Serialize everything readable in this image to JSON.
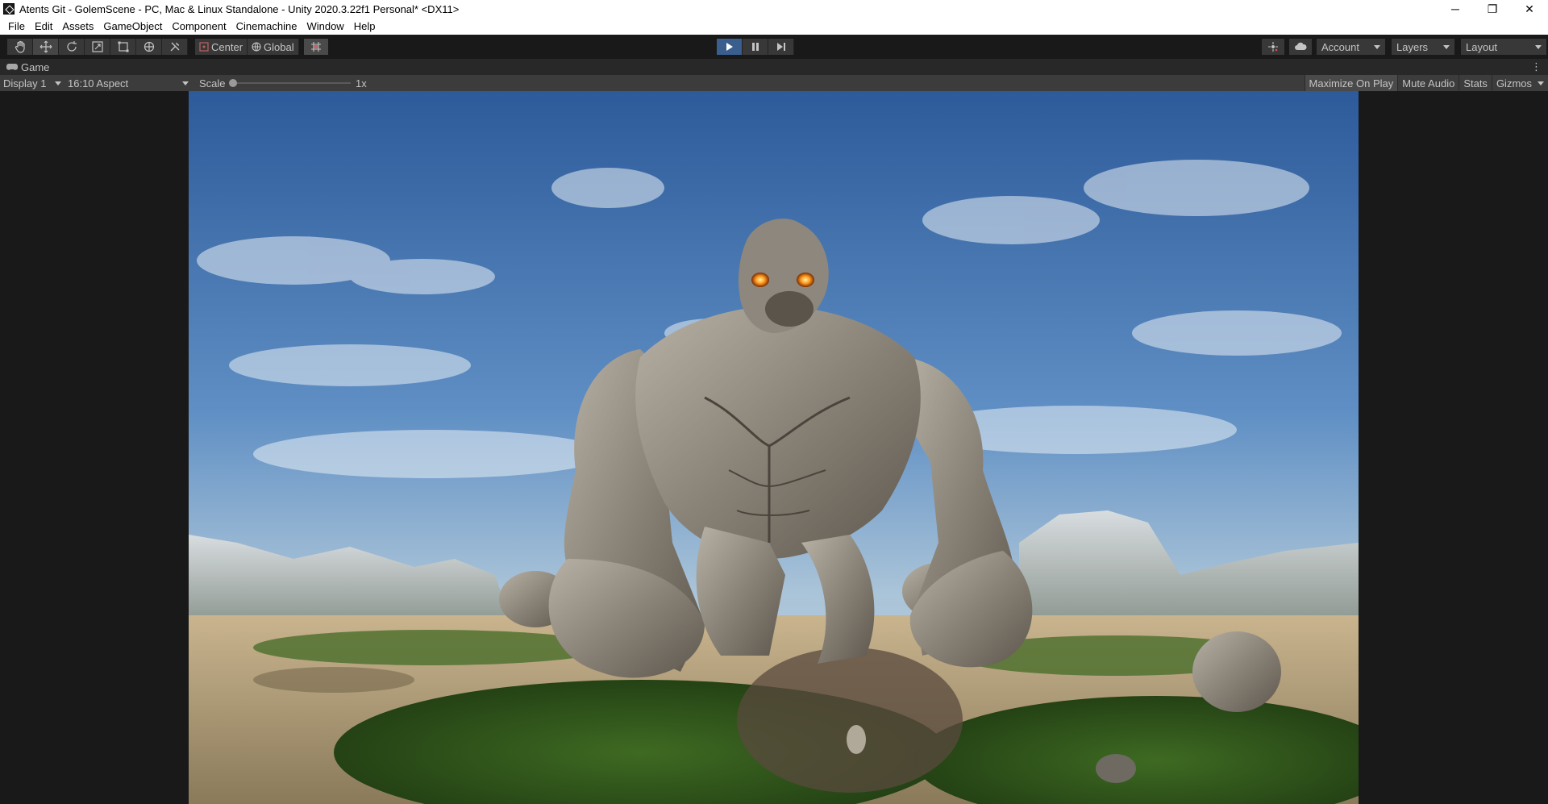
{
  "window": {
    "title": "Atents Git - GolemScene - PC, Mac & Linux Standalone - Unity 2020.3.22f1 Personal* <DX11>",
    "controls": {
      "minimize": "─",
      "restore": "❐",
      "close": "✕"
    }
  },
  "menubar": {
    "items": [
      {
        "label": "File"
      },
      {
        "label": "Edit"
      },
      {
        "label": "Assets"
      },
      {
        "label": "GameObject"
      },
      {
        "label": "Component"
      },
      {
        "label": "Cinemachine"
      },
      {
        "label": "Window"
      },
      {
        "label": "Help"
      }
    ]
  },
  "toolbar": {
    "tools": [
      "hand-tool",
      "move-tool",
      "rotate-tool",
      "scale-tool",
      "rect-tool",
      "transform-tool",
      "custom-tool"
    ],
    "active_tool": "move-tool",
    "pivot_mode": "Center",
    "pivot_rotation": "Global",
    "play_state": "playing",
    "account_label": "Account",
    "layers_label": "Layers",
    "layout_label": "Layout"
  },
  "game_tab": {
    "label": "Game",
    "menu": "⋮"
  },
  "game_view": {
    "display": "Display 1",
    "aspect": "16:10 Aspect",
    "scale_label": "Scale",
    "scale_value": "1x",
    "scale_fraction": 0,
    "buttons": {
      "maximize": "Maximize On Play",
      "mute": "Mute Audio",
      "stats": "Stats",
      "gizmos": "Gizmos"
    }
  },
  "colors": {
    "play_active": "#3a5f8f",
    "editor_bg": "#191919",
    "panel_bg": "#383838"
  }
}
